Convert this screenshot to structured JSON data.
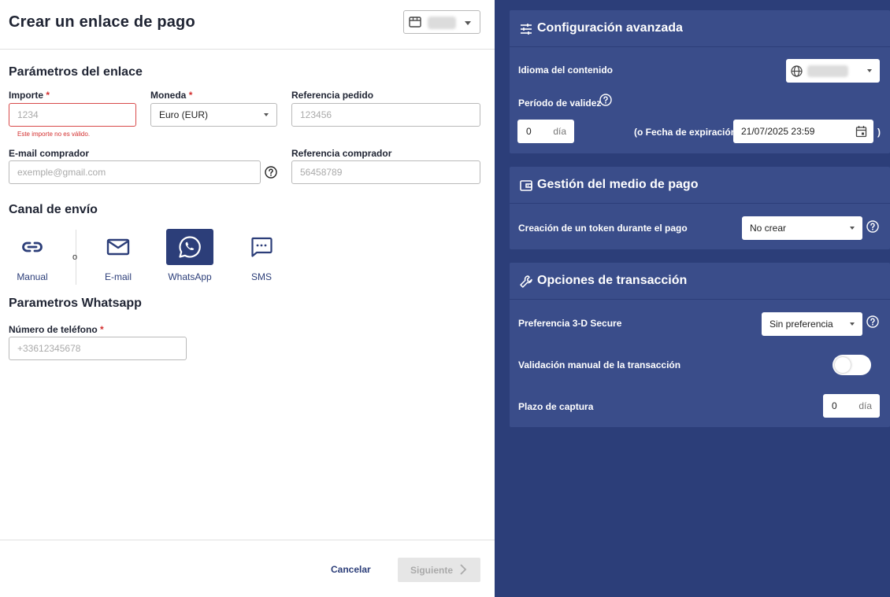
{
  "header": {
    "title": "Crear un enlace de pago"
  },
  "link_params": {
    "section_title": "Parámetros del enlace",
    "amount": {
      "label": "Importe",
      "required_mark": "*",
      "placeholder": "1234",
      "error": "Este importe no es válido."
    },
    "currency": {
      "label": "Moneda",
      "required_mark": "*",
      "value": "Euro (EUR)"
    },
    "order_ref": {
      "label": "Referencia pedido",
      "placeholder": "123456"
    },
    "buyer_email": {
      "label": "E-mail comprador",
      "placeholder": "exemple@gmail.com"
    },
    "buyer_ref": {
      "label": "Referencia comprador",
      "placeholder": "56458789"
    }
  },
  "channel": {
    "section_title": "Canal de envío",
    "separator": "o",
    "options": [
      {
        "label": "Manual",
        "icon": "link-icon"
      },
      {
        "label": "E-mail",
        "icon": "mail-icon"
      },
      {
        "label": "WhatsApp",
        "icon": "whatsapp-icon",
        "selected": true
      },
      {
        "label": "SMS",
        "icon": "sms-icon"
      }
    ]
  },
  "whatsapp": {
    "section_title": "Parametros Whatsapp",
    "phone": {
      "label": "Número de teléfono",
      "required_mark": "*",
      "placeholder": "+33612345678"
    }
  },
  "footer": {
    "cancel": "Cancelar",
    "next": "Siguiente"
  },
  "advanced": {
    "title": "Configuración avanzada",
    "language_label": "Idioma del contenido",
    "validity_label": "Período de validez",
    "validity_value": "0",
    "validity_unit": "día",
    "expiry_open": "(o Fecha de expiración",
    "expiry_value": "21/07/2025 23:59",
    "expiry_close": ")"
  },
  "payment_method": {
    "title": "Gestión del medio de pago",
    "token_label": "Creación de un token durante el pago",
    "token_value": "No crear"
  },
  "transaction": {
    "title": "Opciones de transacción",
    "secure_label": "Preferencia 3-D Secure",
    "secure_value": "Sin preferencia",
    "manual_label": "Validación manual de la transacción",
    "manual_on": false,
    "capture_label": "Plazo de captura",
    "capture_value": "0",
    "capture_unit": "día"
  },
  "colors": {
    "brand": "#2c3e79",
    "card": "#3a4d8a",
    "error": "#d32f2f"
  }
}
